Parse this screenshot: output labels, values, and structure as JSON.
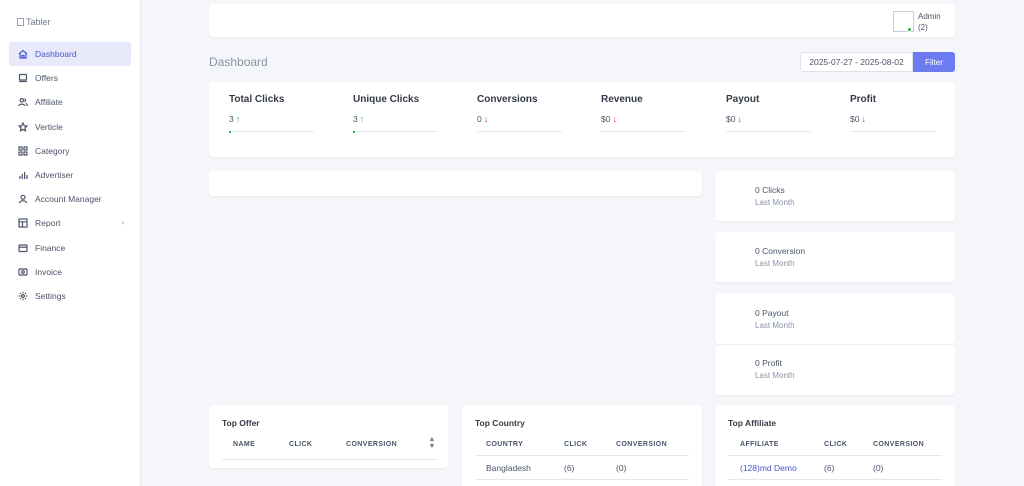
{
  "brand": {
    "logo_alt": "Tabler"
  },
  "sidebar": {
    "items": [
      {
        "label": "Dashboard",
        "icon": "home-icon"
      },
      {
        "label": "Offers",
        "icon": "device-icon"
      },
      {
        "label": "Affiliate",
        "icon": "users-icon"
      },
      {
        "label": "Verticle",
        "icon": "star-icon"
      },
      {
        "label": "Category",
        "icon": "grid-icon"
      },
      {
        "label": "Advertiser",
        "icon": "chart-bars-icon"
      },
      {
        "label": "Account Manager",
        "icon": "user-icon"
      },
      {
        "label": "Report",
        "icon": "layout-icon"
      },
      {
        "label": "Finance",
        "icon": "wallet-icon"
      },
      {
        "label": "Invoice",
        "icon": "cash-icon"
      },
      {
        "label": "Settings",
        "icon": "gear-icon"
      }
    ]
  },
  "header": {
    "user_name": "Admin",
    "user_sub": "(2)"
  },
  "page": {
    "title": "Dashboard",
    "date_range": "2025-07-27 - 2025-08-02",
    "filter_label": "Filter"
  },
  "stats": [
    {
      "label": "Total Clicks",
      "value": "3",
      "trend": "up"
    },
    {
      "label": "Unique Clicks",
      "value": "3",
      "trend": "up"
    },
    {
      "label": "Conversions",
      "value": "0",
      "trend": "down"
    },
    {
      "label": "Revenue",
      "value": "$0",
      "trend": "down"
    },
    {
      "label": "Payout",
      "value": "$0",
      "trend": "down"
    },
    {
      "label": "Profit",
      "value": "$0",
      "trend": "down"
    }
  ],
  "mini_cards": [
    {
      "value": "0 Clicks",
      "period": "Last Month"
    },
    {
      "value": "0 Conversion",
      "period": "Last Month"
    },
    {
      "value": "0 Payout",
      "period": "Last Month"
    },
    {
      "value": "0 Profit",
      "period": "Last Month"
    }
  ],
  "top_offer": {
    "title": "Top Offer",
    "columns": [
      "NAME",
      "CLICK",
      "CONVERSION"
    ]
  },
  "top_country": {
    "title": "Top Country",
    "columns": [
      "COUNTRY",
      "CLICK",
      "CONVERSION"
    ],
    "rows": [
      [
        "Bangladesh",
        "(6)",
        "(0)"
      ]
    ]
  },
  "top_affiliate": {
    "title": "Top Affiliate",
    "columns": [
      "AFFILIATE",
      "CLICK",
      "CONVERSION"
    ],
    "rows": [
      [
        "(128)md Demo",
        "(6)",
        "(0)"
      ]
    ]
  }
}
